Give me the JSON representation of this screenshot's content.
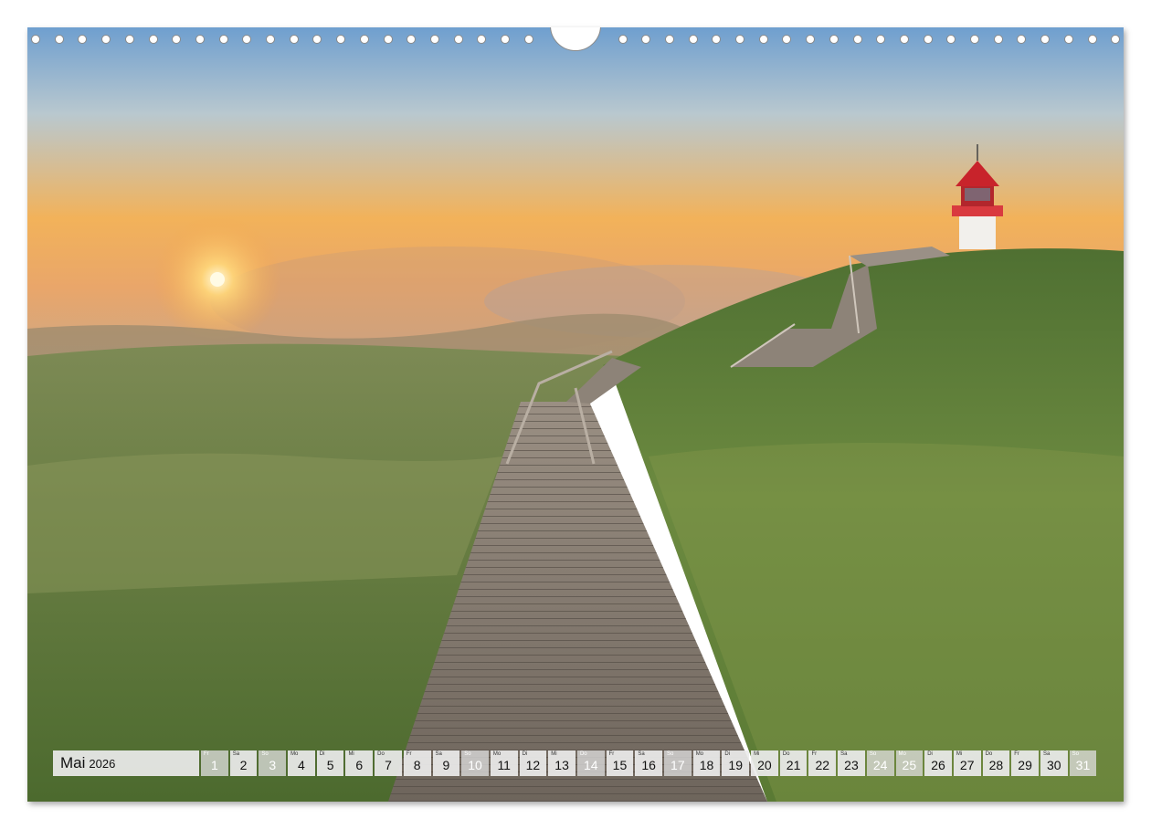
{
  "calendar": {
    "month": "Mai",
    "year": "2026",
    "days": [
      {
        "wd": "Fr",
        "d": "1",
        "weekend": true
      },
      {
        "wd": "Sa",
        "d": "2",
        "weekend": false
      },
      {
        "wd": "So",
        "d": "3",
        "weekend": true
      },
      {
        "wd": "Mo",
        "d": "4",
        "weekend": false
      },
      {
        "wd": "Di",
        "d": "5",
        "weekend": false
      },
      {
        "wd": "Mi",
        "d": "6",
        "weekend": false
      },
      {
        "wd": "Do",
        "d": "7",
        "weekend": false
      },
      {
        "wd": "Fr",
        "d": "8",
        "weekend": false
      },
      {
        "wd": "Sa",
        "d": "9",
        "weekend": false
      },
      {
        "wd": "So",
        "d": "10",
        "weekend": true
      },
      {
        "wd": "Mo",
        "d": "11",
        "weekend": false
      },
      {
        "wd": "Di",
        "d": "12",
        "weekend": false
      },
      {
        "wd": "Mi",
        "d": "13",
        "weekend": false
      },
      {
        "wd": "Do",
        "d": "14",
        "weekend": true
      },
      {
        "wd": "Fr",
        "d": "15",
        "weekend": false
      },
      {
        "wd": "Sa",
        "d": "16",
        "weekend": false
      },
      {
        "wd": "So",
        "d": "17",
        "weekend": true
      },
      {
        "wd": "Mo",
        "d": "18",
        "weekend": false
      },
      {
        "wd": "Di",
        "d": "19",
        "weekend": false
      },
      {
        "wd": "Mi",
        "d": "20",
        "weekend": false
      },
      {
        "wd": "Do",
        "d": "21",
        "weekend": false
      },
      {
        "wd": "Fr",
        "d": "22",
        "weekend": false
      },
      {
        "wd": "Sa",
        "d": "23",
        "weekend": false
      },
      {
        "wd": "So",
        "d": "24",
        "weekend": true
      },
      {
        "wd": "Mo",
        "d": "25",
        "weekend": true
      },
      {
        "wd": "Di",
        "d": "26",
        "weekend": false
      },
      {
        "wd": "Mi",
        "d": "27",
        "weekend": false
      },
      {
        "wd": "Do",
        "d": "28",
        "weekend": false
      },
      {
        "wd": "Fr",
        "d": "29",
        "weekend": false
      },
      {
        "wd": "Sa",
        "d": "30",
        "weekend": false
      },
      {
        "wd": "So",
        "d": "31",
        "weekend": true
      }
    ]
  },
  "photo": {
    "subject": "lighthouse-on-dune-with-boardwalk",
    "colors": {
      "sky_top": "#6f9fcf",
      "sky_horizon": "#f2b25a",
      "grass": "#5e7a3a",
      "lighthouse_red": "#c8232b",
      "boardwalk": "#7d7368"
    }
  }
}
